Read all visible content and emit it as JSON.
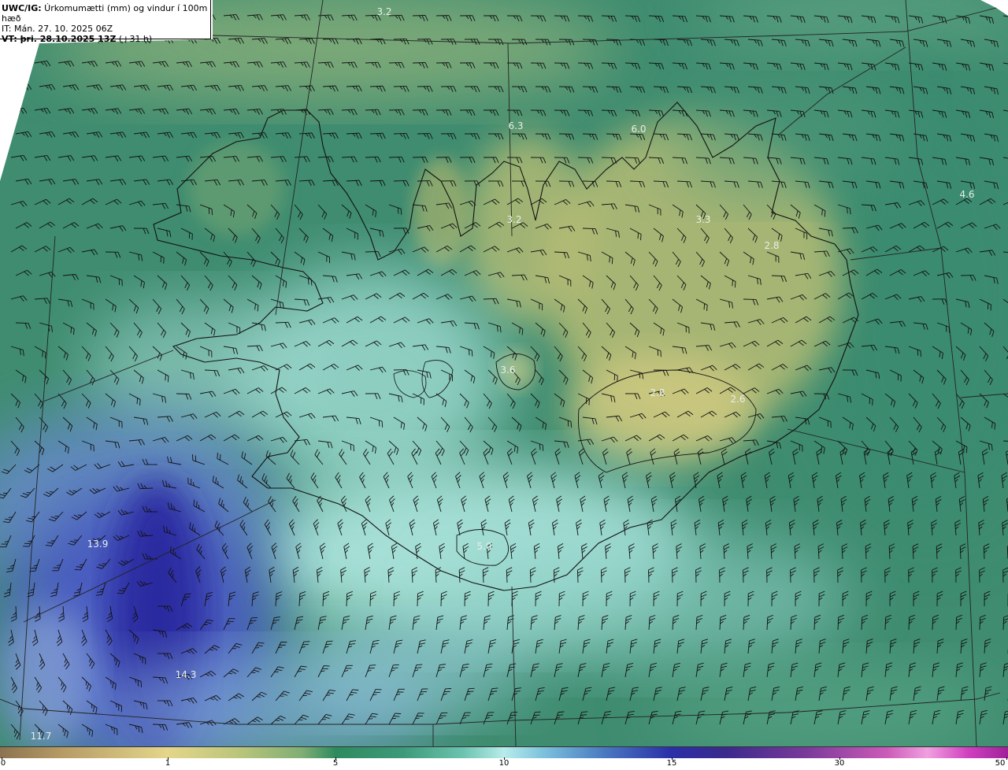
{
  "header": {
    "title_bold": "UWC/IG:",
    "title_rest": " Úrkomumætti (mm) og vindur í 100m hæð",
    "it_line": "IT: Mán. 27. 10. 2025 06Z",
    "vt_bold": "VT: þri. 28.10.2025 13Z",
    "vt_rest": " (+31 h)"
  },
  "map_labels": [
    {
      "id": "label-3-2-north",
      "text": "3.2"
    },
    {
      "id": "label-6-3",
      "text": "6.3"
    },
    {
      "id": "label-6-0",
      "text": "6.0"
    },
    {
      "id": "label-4-6",
      "text": "4.6"
    },
    {
      "id": "label-3-2-center",
      "text": "3.2"
    },
    {
      "id": "label-3-3",
      "text": "3.3"
    },
    {
      "id": "label-2-8",
      "text": "2.8"
    },
    {
      "id": "label-3-6",
      "text": "3.6"
    },
    {
      "id": "label-2-8-south",
      "text": "2.8"
    },
    {
      "id": "label-2-6",
      "text": "2.6"
    },
    {
      "id": "label-5-0",
      "text": "5.0"
    },
    {
      "id": "label-13-9",
      "text": "13.9"
    },
    {
      "id": "label-14-3",
      "text": "14.3"
    },
    {
      "id": "label-11-7",
      "text": "11.7"
    }
  ],
  "colorbar": {
    "ticks": [
      "0",
      "1",
      "5",
      "10",
      "15",
      "30",
      "50"
    ]
  },
  "colors": {
    "ocean_green": "#3a8a72",
    "land_yellow": "#c9c47a",
    "cyan_light": "#bdeee8",
    "deep_blue": "#2a2a9c"
  }
}
